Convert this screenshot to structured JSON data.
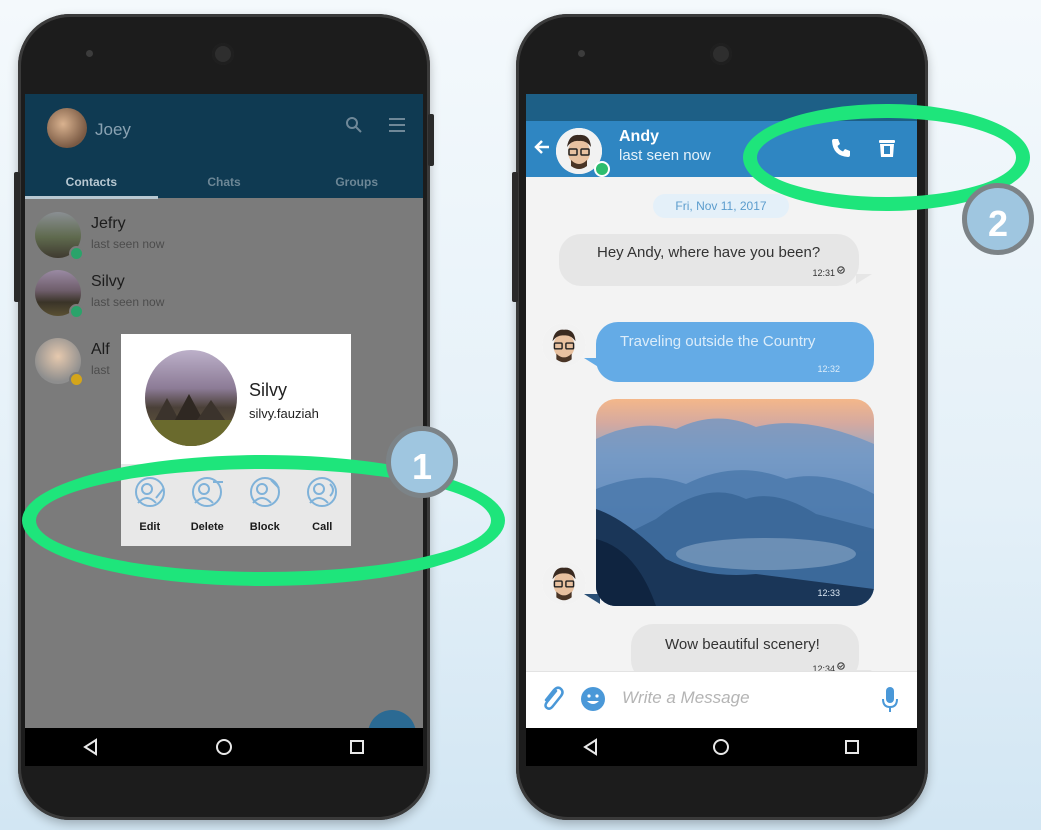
{
  "left_screen": {
    "header": {
      "user_name": "Joey"
    },
    "tabs": [
      {
        "label": "Contacts"
      },
      {
        "label": "Chats"
      },
      {
        "label": "Groups"
      }
    ],
    "contacts": [
      {
        "name": "Jefry",
        "status": "last seen now"
      },
      {
        "name": "Silvy",
        "status": "last seen now"
      },
      {
        "name": "Alf",
        "status": "last"
      }
    ],
    "popup": {
      "name": "Silvy",
      "username": "silvy.fauziah",
      "actions": [
        {
          "label": "Edit"
        },
        {
          "label": "Delete"
        },
        {
          "label": "Block"
        },
        {
          "label": "Call"
        }
      ]
    }
  },
  "right_screen": {
    "header": {
      "name": "Andy",
      "status": "last seen now"
    },
    "date_separator": "Fri, Nov 11, 2017",
    "messages": [
      {
        "direction": "incoming",
        "text": "Hey Andy, where have you been?",
        "time": "12:31"
      },
      {
        "direction": "outgoing",
        "text": "Traveling outside the Country",
        "time": "12:32"
      },
      {
        "direction": "outgoing",
        "type": "image",
        "time": "12:33"
      },
      {
        "direction": "incoming",
        "text": "Wow beautiful scenery!",
        "time": "12:34"
      }
    ],
    "compose": {
      "placeholder": "Write a Message"
    }
  },
  "highlights": [
    {
      "number": "1"
    },
    {
      "number": "2"
    }
  ],
  "colors": {
    "accent": "#2f86c2",
    "highlight": "#1ee57b",
    "badge": "#9fc6e0"
  }
}
